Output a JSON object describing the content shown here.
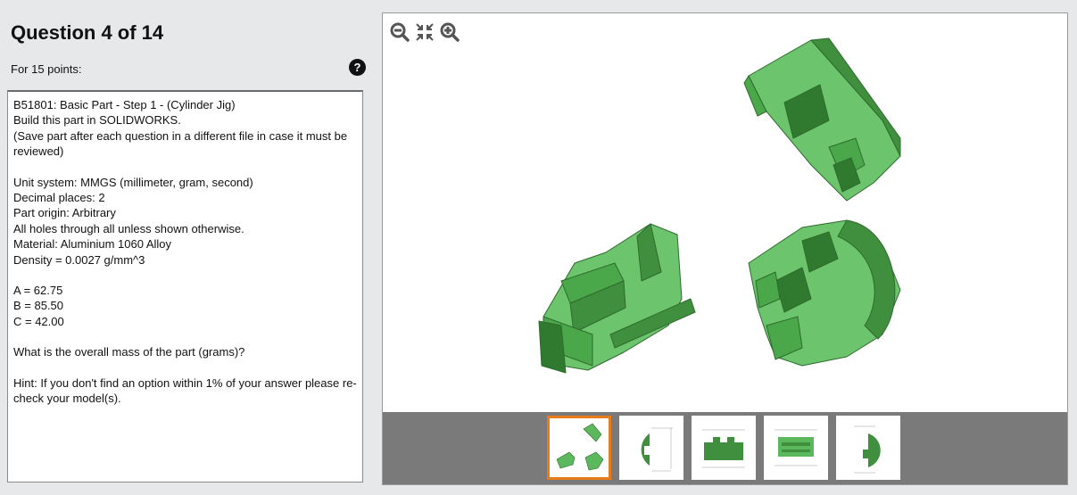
{
  "question": {
    "title": "Question 4 of 14",
    "points": "For 15 points:",
    "help_glyph": "?",
    "lines": {
      "l1": "B51801:  Basic Part - Step 1 - (Cylinder Jig)",
      "l2": "Build this part in SOLIDWORKS.",
      "l3": "(Save part after each question in a different file in case it must be reviewed)",
      "l4": "Unit system: MMGS (millimeter, gram, second)",
      "l5": "Decimal places: 2",
      "l6": "Part origin: Arbitrary",
      "l7": "All holes through all unless shown otherwise.",
      "l8": "Material: Aluminium 1060 Alloy",
      "l9": "Density = 0.0027 g/mm^3",
      "l10": "A = 62.75",
      "l11": "B = 85.50",
      "l12": "C = 42.00",
      "l13": "What is the overall mass of the part (grams)?",
      "l14": "Hint: If you don't find an option within 1% of your answer please re-check your model(s)."
    }
  },
  "viewer": {
    "toolbar": [
      "zoom-out-icon",
      "fit-to-screen-icon",
      "zoom-in-icon"
    ],
    "part_color": "#5cb85c",
    "selected_border_color": "#e87c1c",
    "thumbnails": [
      "isometric-views",
      "side-view-drawing",
      "front-view-drawing",
      "top-view-drawing",
      "right-view-drawing"
    ],
    "selected_thumbnail": 0
  }
}
